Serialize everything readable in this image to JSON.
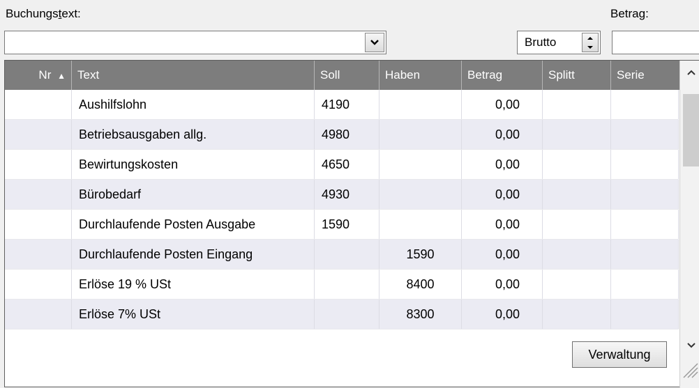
{
  "labels": {
    "buchungstext_pre": "Buchungs",
    "buchungstext_ul": "t",
    "buchungstext_post": "ext:",
    "betrag_pre": "Betra",
    "betrag_ul": "g",
    "betrag_post": ":"
  },
  "text_combo": {
    "value": ""
  },
  "brutto": {
    "value": "Brutto"
  },
  "betrag_field": {
    "value": ""
  },
  "table": {
    "columns": [
      "Nr",
      "Text",
      "Soll",
      "Haben",
      "Betrag",
      "Splitt",
      "Serie"
    ],
    "sort_indicator": "▲",
    "rows": [
      {
        "nr": "",
        "text": "Aushilfslohn",
        "soll": "4190",
        "haben": "",
        "betrag": "0,00",
        "splitt": "",
        "serie": ""
      },
      {
        "nr": "",
        "text": "Betriebsausgaben allg.",
        "soll": "4980",
        "haben": "",
        "betrag": "0,00",
        "splitt": "",
        "serie": ""
      },
      {
        "nr": "",
        "text": "Bewirtungskosten",
        "soll": "4650",
        "haben": "",
        "betrag": "0,00",
        "splitt": "",
        "serie": ""
      },
      {
        "nr": "",
        "text": "Bürobedarf",
        "soll": "4930",
        "haben": "",
        "betrag": "0,00",
        "splitt": "",
        "serie": ""
      },
      {
        "nr": "",
        "text": "Durchlaufende Posten Ausgabe",
        "soll": "1590",
        "haben": "",
        "betrag": "0,00",
        "splitt": "",
        "serie": ""
      },
      {
        "nr": "",
        "text": "Durchlaufende Posten Eingang",
        "soll": "",
        "haben": "1590",
        "betrag": "0,00",
        "splitt": "",
        "serie": ""
      },
      {
        "nr": "",
        "text": "Erlöse 19 % USt",
        "soll": "",
        "haben": "8400",
        "betrag": "0,00",
        "splitt": "",
        "serie": ""
      },
      {
        "nr": "",
        "text": "Erlöse 7% USt",
        "soll": "",
        "haben": "8300",
        "betrag": "0,00",
        "splitt": "",
        "serie": ""
      }
    ]
  },
  "buttons": {
    "verwaltung": "Verwaltung"
  },
  "icons": {
    "combo": "chevron-down-icon",
    "spin_up": "triangle-up-icon",
    "spin_down": "triangle-down-icon",
    "scroll_up": "chevron-up-icon",
    "scroll_down": "chevron-down-icon",
    "grip": "resize-grip-icon"
  },
  "colors": {
    "header_bg": "#7d7d7d",
    "alt_row": "#ebebf3"
  }
}
